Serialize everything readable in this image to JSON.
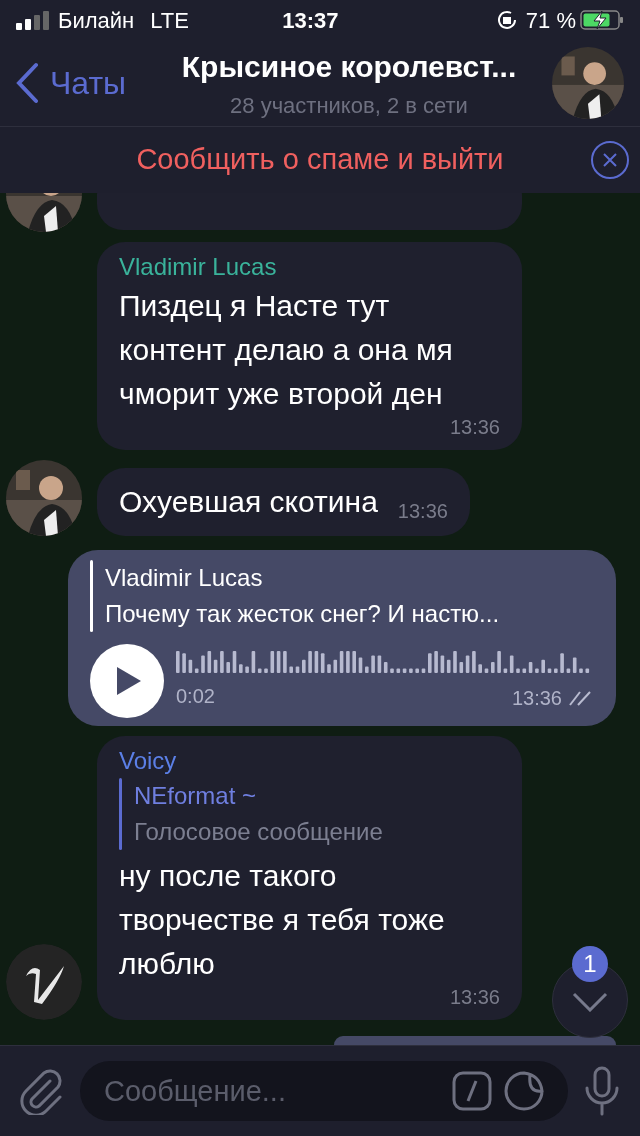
{
  "status_bar": {
    "carrier": "Билайн",
    "network": "LTE",
    "time": "13:37",
    "battery": "71 %",
    "charging": true
  },
  "header": {
    "back": "Чаты",
    "title": "Крысиное королевст...",
    "subtitle": "28 участников, 2 в сети"
  },
  "banner": {
    "text": "Сообщить о спаме и выйти"
  },
  "messages": [
    {
      "kind": "partial",
      "outgoing": false
    },
    {
      "kind": "text",
      "outgoing": false,
      "sender": "Vladimir Lucas",
      "color": "#3ab39b",
      "text": "Пиздец я Насте тут контент делаю а она мя чморит уже второй ден",
      "time": "13:36"
    },
    {
      "kind": "text",
      "outgoing": false,
      "text": "Охуевшая скотина",
      "time": "13:36"
    },
    {
      "kind": "voice",
      "outgoing": true,
      "reply_name": "Vladimir Lucas",
      "reply_text": "Почему так жесток снег? И настю...",
      "duration": "0:02",
      "time": "13:36",
      "read": true
    },
    {
      "kind": "text",
      "outgoing": false,
      "avatar": {
        "kind": "logo"
      },
      "sender": "Voicy",
      "color": "#5b7fe6",
      "reply_name": "NEformat ~",
      "reply_text": "Голосовое сообщение",
      "text": "ну после такого творчестве я тебя тоже люблю",
      "time": "13:36"
    },
    {
      "kind": "partial",
      "outgoing": true
    }
  ],
  "scroll_button": {
    "badge": "1"
  },
  "composer": {
    "placeholder": "Сообщение..."
  }
}
